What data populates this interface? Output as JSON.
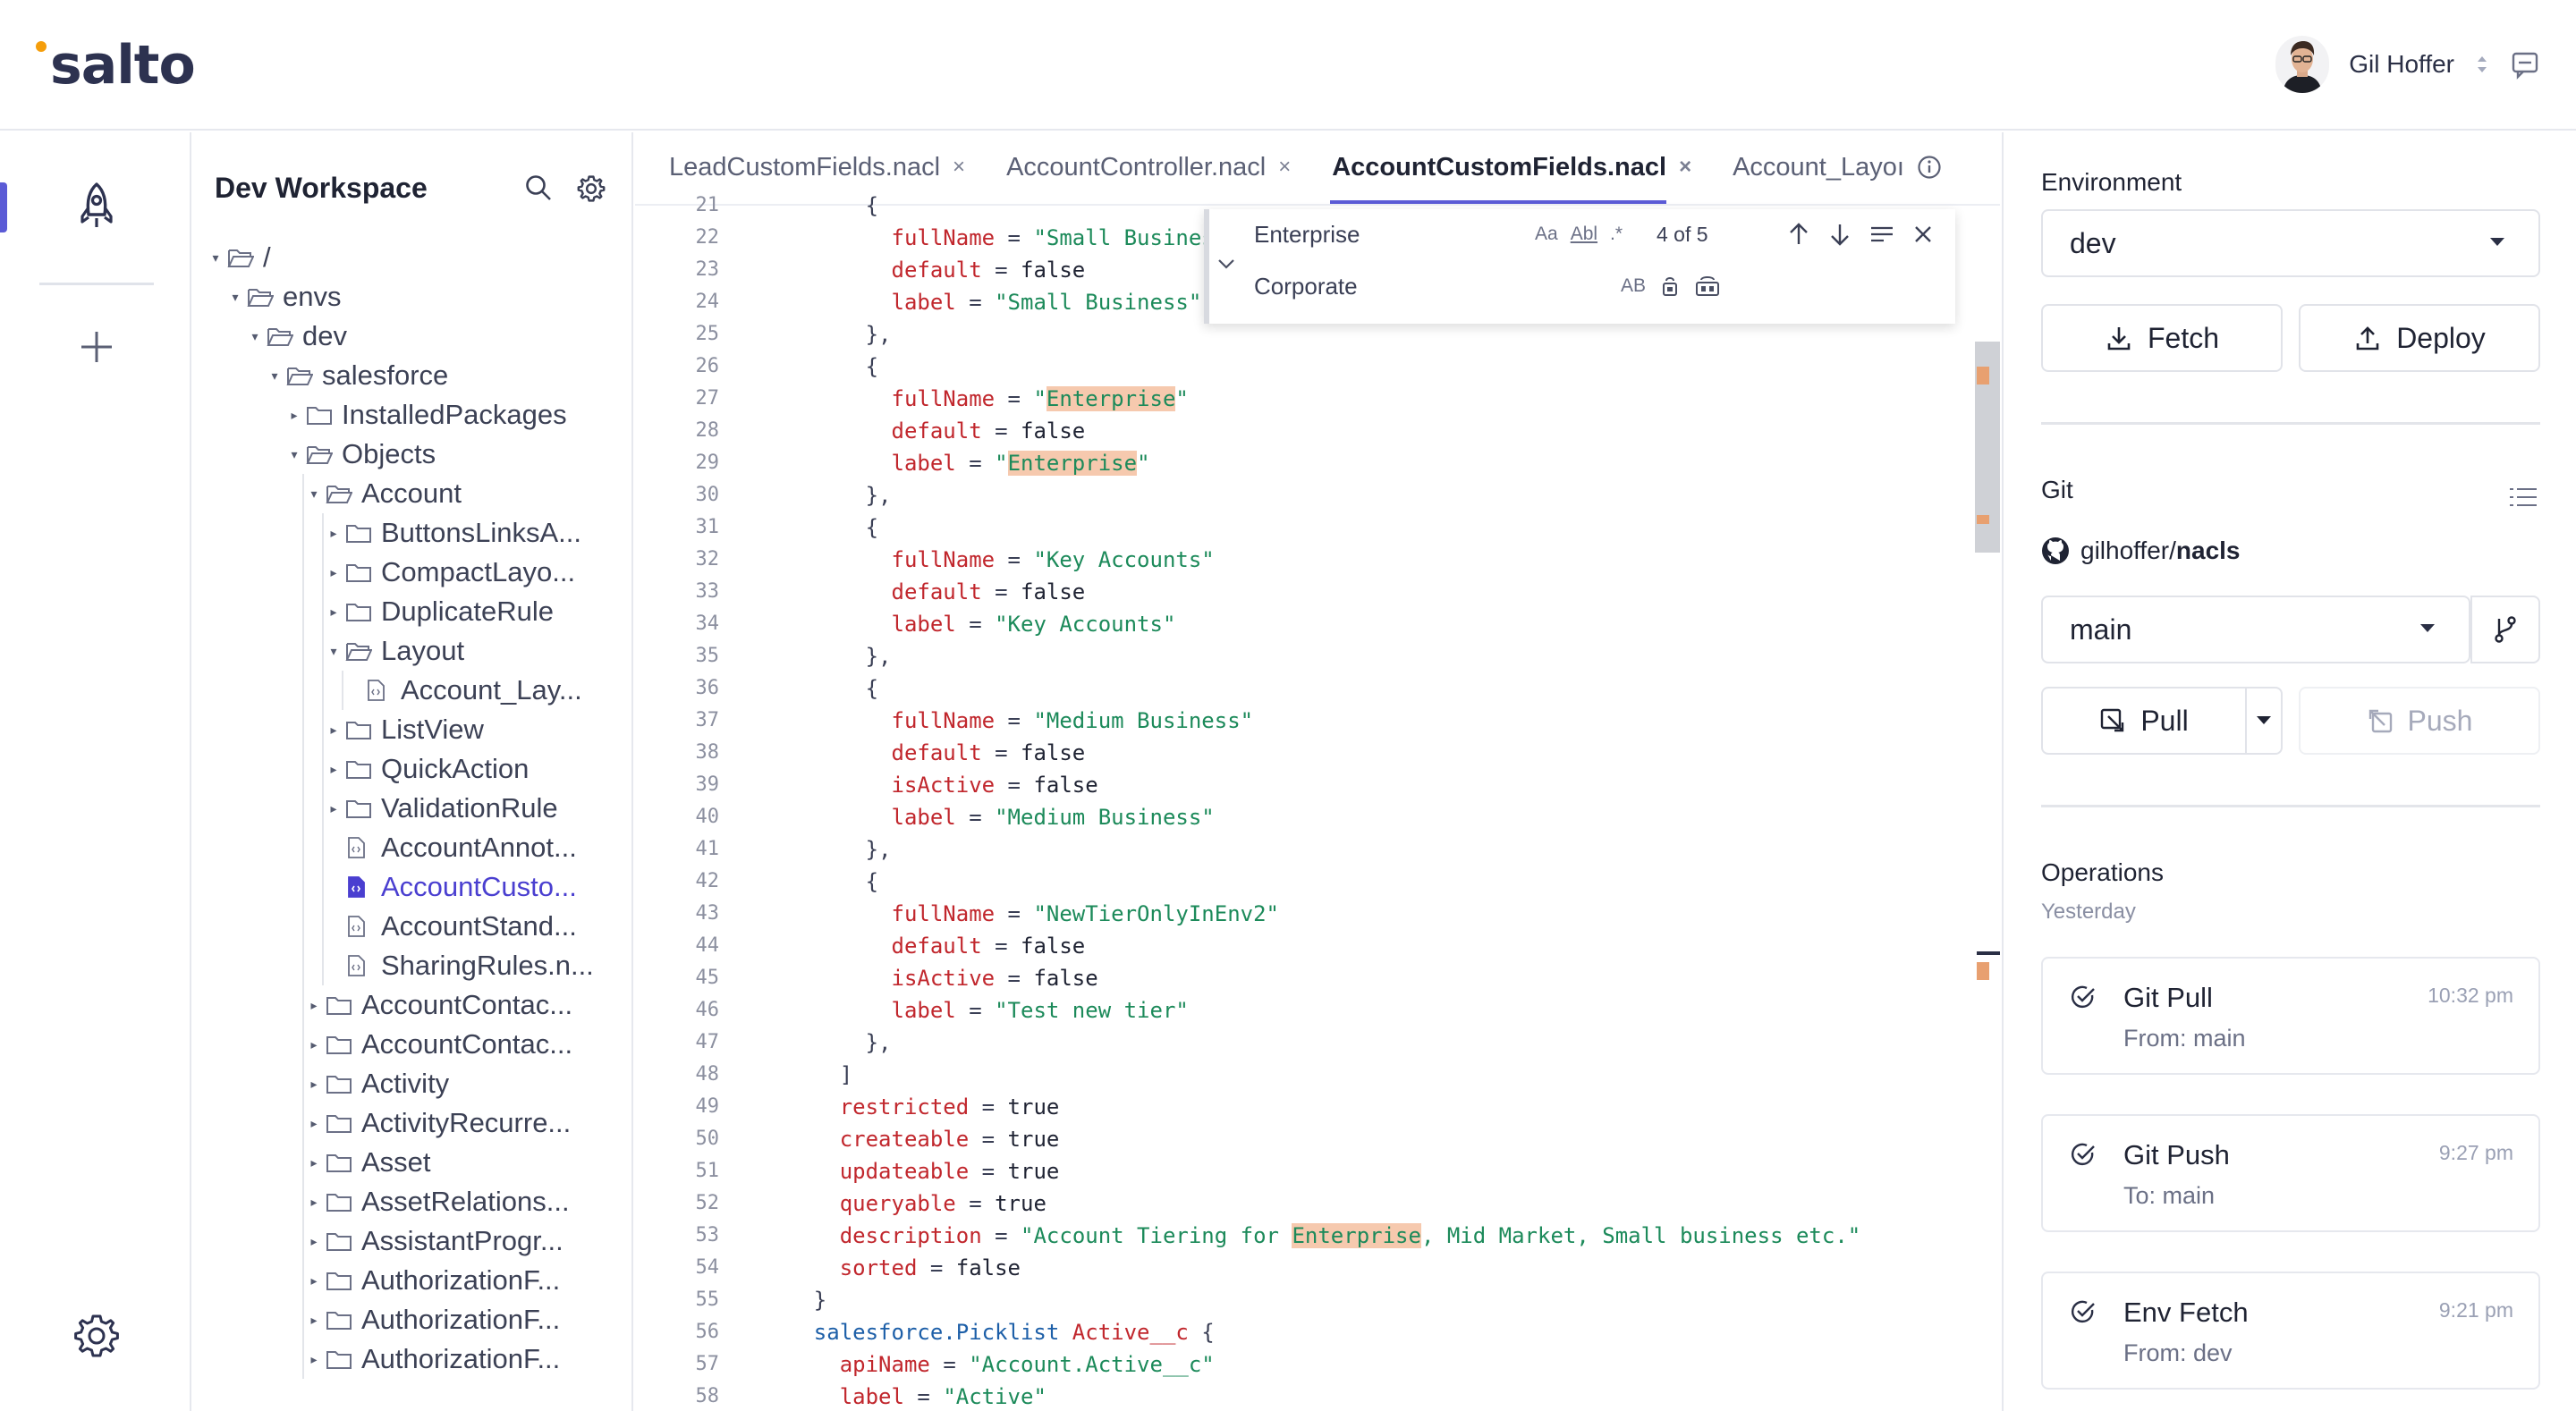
{
  "app": {
    "logo_text": "salto",
    "logo_dot_color": "#f59e0b",
    "accent_color": "#5b5bd6"
  },
  "header": {
    "user_name": "Gil Hoffer",
    "avatar_icon": "user-avatar",
    "sort_icon": "sort-icon",
    "message_icon": "message-icon"
  },
  "rail": {
    "items": [
      {
        "icon": "rocket-icon",
        "active": true
      },
      {
        "icon": "plus-icon",
        "active": false
      }
    ],
    "settings_icon": "gear-icon"
  },
  "tree": {
    "title": "Dev Workspace",
    "rows": [
      {
        "label": "/",
        "depth": 0,
        "type": "folder",
        "open": true
      },
      {
        "label": "envs",
        "depth": 1,
        "type": "folder",
        "open": true
      },
      {
        "label": "dev",
        "depth": 2,
        "type": "folder",
        "open": true
      },
      {
        "label": "salesforce",
        "depth": 3,
        "type": "folder",
        "open": true
      },
      {
        "label": "InstalledPackages",
        "depth": 4,
        "type": "folder",
        "open": false
      },
      {
        "label": "Objects",
        "depth": 4,
        "type": "folder",
        "open": true
      },
      {
        "label": "Account",
        "depth": 5,
        "type": "folder",
        "open": true
      },
      {
        "label": "ButtonsLinksA...",
        "depth": 6,
        "type": "folder",
        "open": false
      },
      {
        "label": "CompactLayo...",
        "depth": 6,
        "type": "folder",
        "open": false
      },
      {
        "label": "DuplicateRule",
        "depth": 6,
        "type": "folder",
        "open": false
      },
      {
        "label": "Layout",
        "depth": 6,
        "type": "folder",
        "open": true
      },
      {
        "label": "Account_Lay...",
        "depth": 7,
        "type": "file"
      },
      {
        "label": "ListView",
        "depth": 6,
        "type": "folder",
        "open": false
      },
      {
        "label": "QuickAction",
        "depth": 6,
        "type": "folder",
        "open": false
      },
      {
        "label": "ValidationRule",
        "depth": 6,
        "type": "folder",
        "open": false
      },
      {
        "label": "AccountAnnot...",
        "depth": 6,
        "type": "file"
      },
      {
        "label": "AccountCusto...",
        "depth": 6,
        "type": "file",
        "selected": true
      },
      {
        "label": "AccountStand...",
        "depth": 6,
        "type": "file"
      },
      {
        "label": "SharingRules.n...",
        "depth": 6,
        "type": "file"
      },
      {
        "label": "AccountContac...",
        "depth": 5,
        "type": "folder",
        "open": false
      },
      {
        "label": "AccountContac...",
        "depth": 5,
        "type": "folder",
        "open": false
      },
      {
        "label": "Activity",
        "depth": 5,
        "type": "folder",
        "open": false
      },
      {
        "label": "ActivityRecurre...",
        "depth": 5,
        "type": "folder",
        "open": false
      },
      {
        "label": "Asset",
        "depth": 5,
        "type": "folder",
        "open": false
      },
      {
        "label": "AssetRelations...",
        "depth": 5,
        "type": "folder",
        "open": false
      },
      {
        "label": "AssistantProgr...",
        "depth": 5,
        "type": "folder",
        "open": false
      },
      {
        "label": "AuthorizationF...",
        "depth": 5,
        "type": "folder",
        "open": false
      },
      {
        "label": "AuthorizationF...",
        "depth": 5,
        "type": "folder",
        "open": false
      },
      {
        "label": "AuthorizationF...",
        "depth": 5,
        "type": "folder",
        "open": false
      }
    ]
  },
  "editor": {
    "tabs": [
      {
        "label": "LeadCustomFields.nacl",
        "active": false,
        "suffix": "close"
      },
      {
        "label": "AccountController.nacl",
        "active": false,
        "suffix": "close"
      },
      {
        "label": "AccountCustomFields.nacl",
        "active": true,
        "suffix": "close"
      },
      {
        "label": "Account_Layoı",
        "active": false,
        "suffix": "info"
      }
    ],
    "find": {
      "search_value": "Enterprise",
      "replace_value": "Corporate",
      "match_case": "Aa",
      "whole_word": "Abl",
      "regex": ".*",
      "count": "4 of 5",
      "preserve_case": "AB"
    },
    "first_line_number": 21,
    "lines": [
      "        {",
      "          fullName = \"Small Business\"",
      "          default = false",
      "          label = \"Small Business\"",
      "        },",
      "        {",
      "          fullName = \"Enterprise\"",
      "          default = false",
      "          label = \"Enterprise\"",
      "        },",
      "        {",
      "          fullName = \"Key Accounts\"",
      "          default = false",
      "          label = \"Key Accounts\"",
      "        },",
      "        {",
      "          fullName = \"Medium Business\"",
      "          default = false",
      "          isActive = false",
      "          label = \"Medium Business\"",
      "        },",
      "        {",
      "          fullName = \"NewTierOnlyInEnv2\"",
      "          default = false",
      "          isActive = false",
      "          label = \"Test new tier\"",
      "        },",
      "      ]",
      "      restricted = true",
      "      createable = true",
      "      updateable = true",
      "      queryable = true",
      "      description = \"Account Tiering for Enterprise, Mid Market, Small business etc.\"",
      "      sorted = false",
      "    }",
      "    salesforce.Picklist Active__c {",
      "      apiName = \"Account.Active__c\"",
      "      label = \"Active\""
    ],
    "highlight_term": "Enterprise"
  },
  "right": {
    "environment_label": "Environment",
    "environment_value": "dev",
    "fetch_label": "Fetch",
    "deploy_label": "Deploy",
    "git_label": "Git",
    "repo_owner": "gilhoffer/",
    "repo_name": "nacls",
    "branch_value": "main",
    "pull_label": "Pull",
    "push_label": "Push",
    "operations_label": "Operations",
    "operations_group": "Yesterday",
    "operations": [
      {
        "title": "Git Pull",
        "subtitle": "From: main",
        "time": "10:32 pm"
      },
      {
        "title": "Git Push",
        "subtitle": "To: main",
        "time": "9:27 pm"
      },
      {
        "title": "Env Fetch",
        "subtitle": "From: dev",
        "time": "9:21 pm"
      }
    ]
  }
}
